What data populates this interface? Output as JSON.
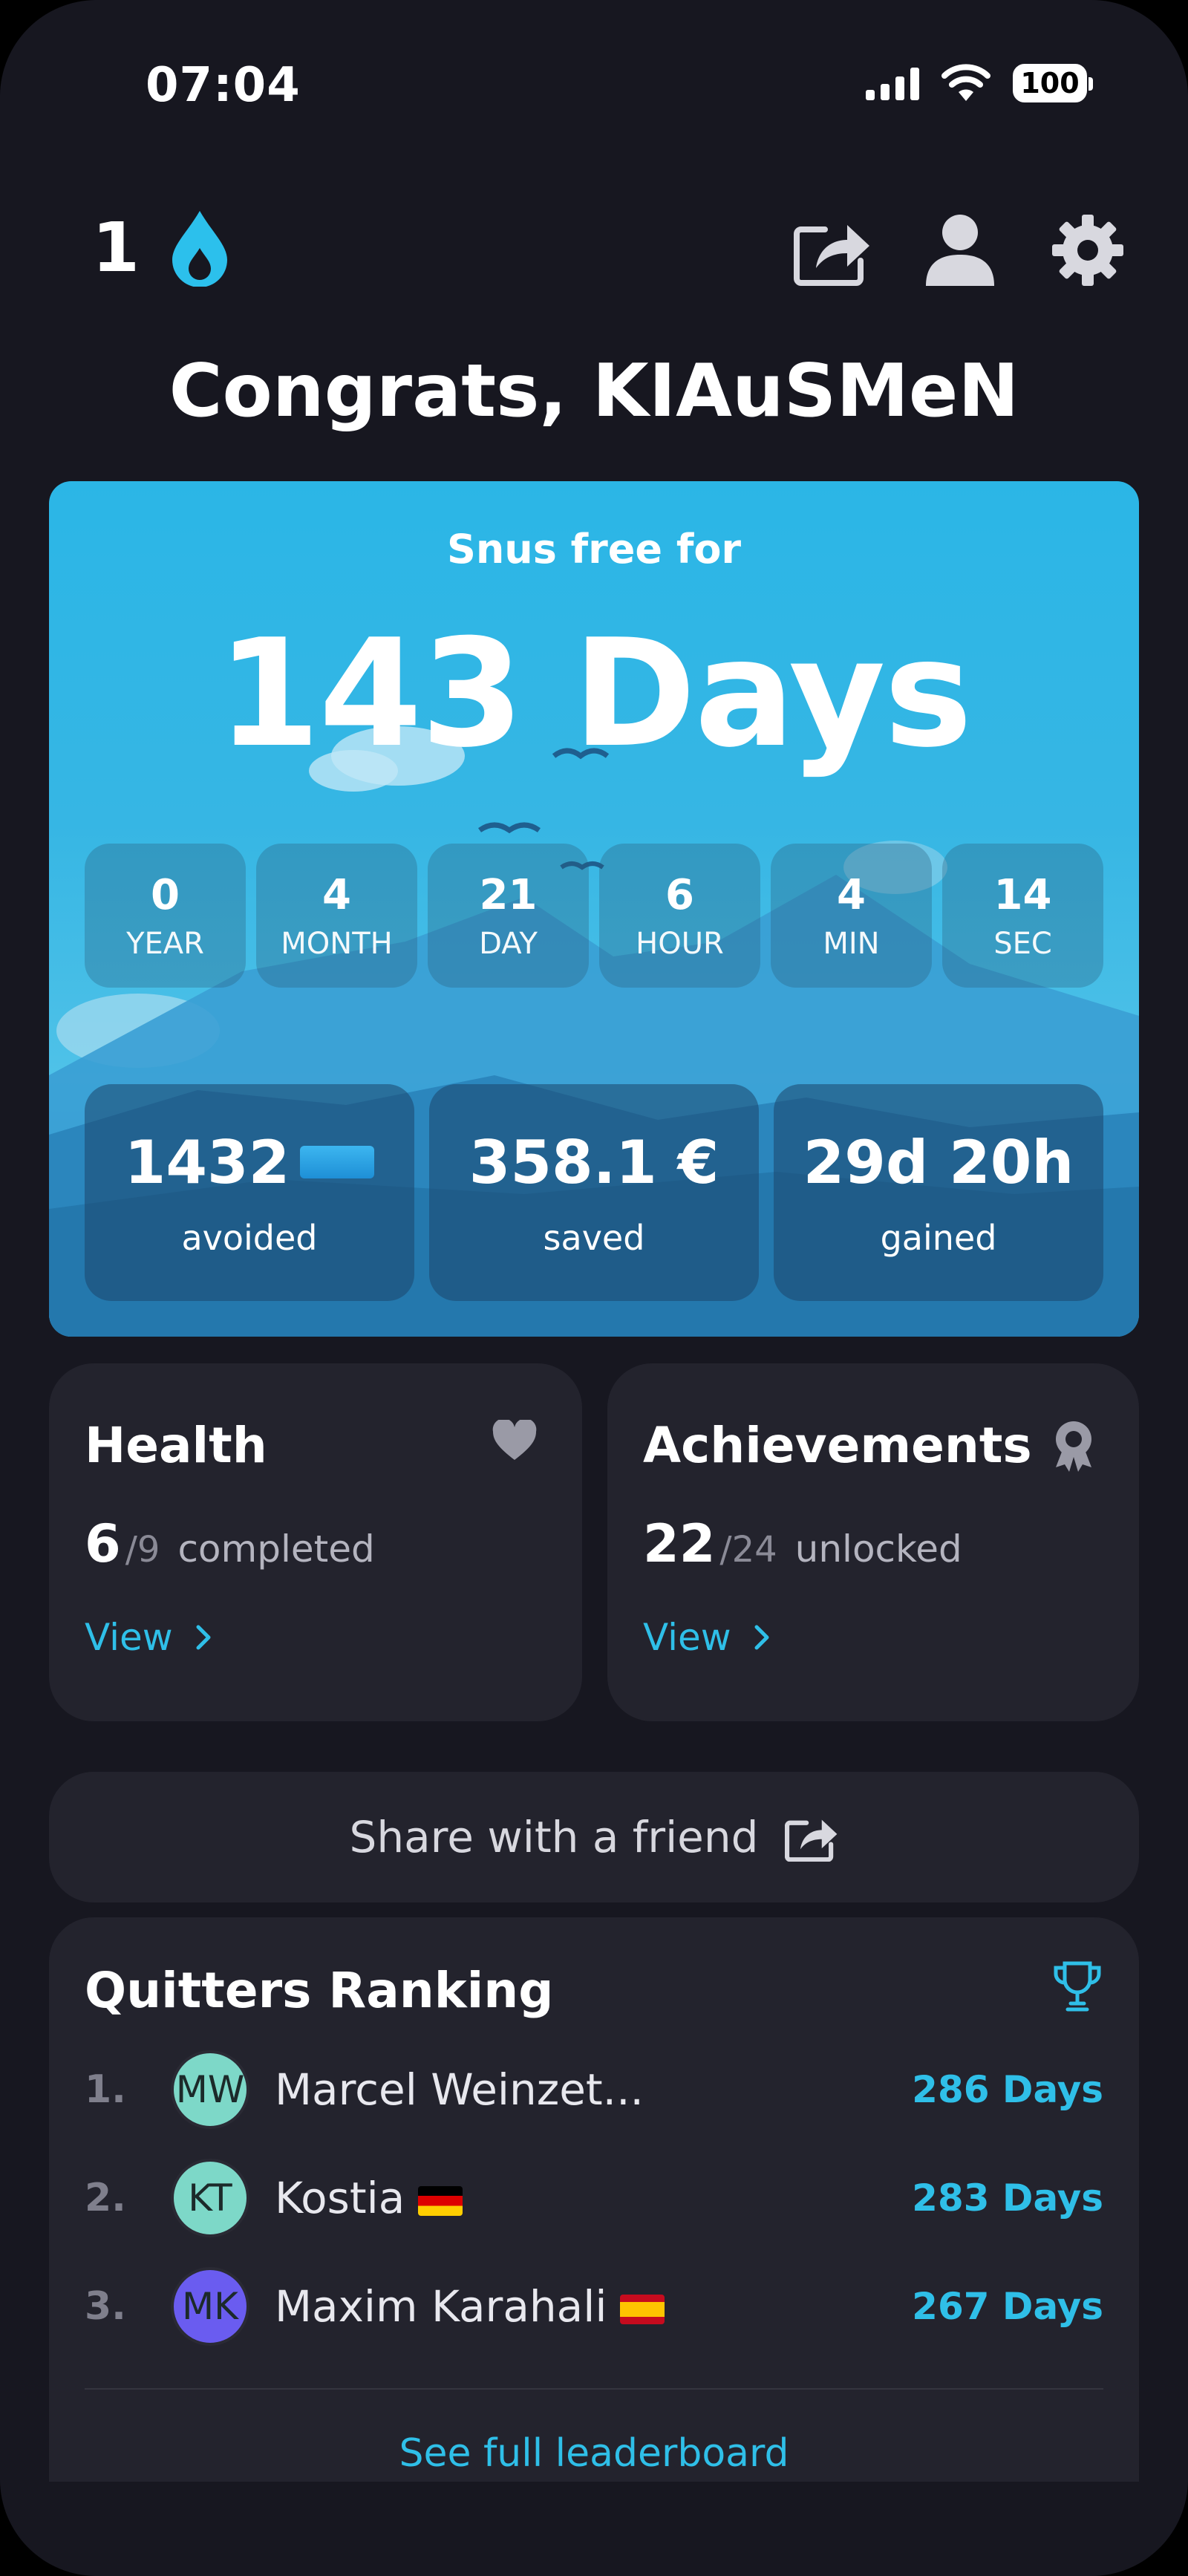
{
  "status_bar": {
    "time": "07:04",
    "battery": "100"
  },
  "header": {
    "streak_count": "1",
    "title": "Congrats, KIAuSMeN"
  },
  "hero": {
    "label": "Snus free for",
    "value": "143 Days",
    "breakdown": [
      {
        "value": "0",
        "unit": "YEAR"
      },
      {
        "value": "4",
        "unit": "MONTH"
      },
      {
        "value": "21",
        "unit": "DAY"
      },
      {
        "value": "6",
        "unit": "HOUR"
      },
      {
        "value": "4",
        "unit": "MIN"
      },
      {
        "value": "14",
        "unit": "SEC"
      }
    ],
    "stats": [
      {
        "value": "1432",
        "label": "avoided"
      },
      {
        "value": "358.1 €",
        "label": "saved"
      },
      {
        "value": "29d 20h",
        "label": "gained"
      }
    ]
  },
  "health": {
    "title": "Health",
    "done": "6",
    "total": "/9",
    "word": "completed",
    "link": "View"
  },
  "achievements": {
    "title": "Achievements",
    "done": "22",
    "total": "/24",
    "word": "unlocked",
    "link": "View"
  },
  "share": {
    "label": "Share with a friend"
  },
  "ranking": {
    "title": "Quitters Ranking",
    "rows": [
      {
        "rank": "1.",
        "initials": "MW",
        "name": "Marcel Weinzet...",
        "days": "286 Days",
        "avatar_color": "#7dd8c8"
      },
      {
        "rank": "2.",
        "initials": "KT",
        "name": "Kostia",
        "days": "283 Days",
        "avatar_color": "#7dd8c8"
      },
      {
        "rank": "3.",
        "initials": "MK",
        "name": "Maxim Karahali",
        "days": "267 Days",
        "avatar_color": "#6a5cf0"
      }
    ],
    "see_full": "See full leaderboard"
  },
  "colors": {
    "accent": "#2fbfe8",
    "background": "#171720",
    "card": "#23232d"
  }
}
